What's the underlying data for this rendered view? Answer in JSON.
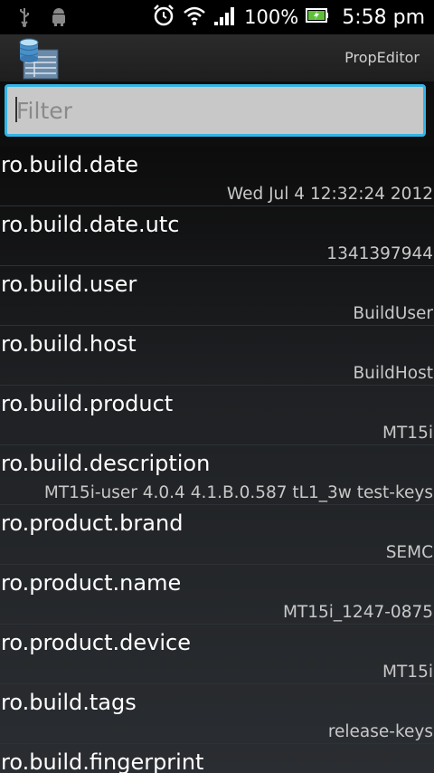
{
  "status_bar": {
    "left_icons": [
      "usb-icon",
      "android-debug-icon"
    ],
    "right_icons": [
      "alarm-clock-icon",
      "wifi-icon",
      "signal-icon",
      "battery-icon"
    ],
    "battery_percent": "100%",
    "time": "5:58 pm"
  },
  "action_bar": {
    "app_icon": "database-icon",
    "title": "PropEditor"
  },
  "filter": {
    "placeholder": "Filter",
    "value": ""
  },
  "props": [
    {
      "key": "ro.build.date",
      "value": "Wed Jul 4 12:32:24 2012"
    },
    {
      "key": "ro.build.date.utc",
      "value": "1341397944"
    },
    {
      "key": "ro.build.user",
      "value": "BuildUser"
    },
    {
      "key": "ro.build.host",
      "value": "BuildHost"
    },
    {
      "key": "ro.build.product",
      "value": "MT15i"
    },
    {
      "key": "ro.build.description",
      "value": "MT15i-user 4.0.4 4.1.B.0.587 tL1_3w test-keys"
    },
    {
      "key": "ro.product.brand",
      "value": "SEMC"
    },
    {
      "key": "ro.product.name",
      "value": "MT15i_1247-0875"
    },
    {
      "key": "ro.product.device",
      "value": "MT15i"
    },
    {
      "key": "ro.build.tags",
      "value": "release-keys"
    },
    {
      "key": "ro.build.fingerprint",
      "value": ""
    }
  ],
  "colors": {
    "accent": "#33b5e5",
    "background": "#000000",
    "list_key_text": "#ffffff",
    "list_value_text": "#c8c8c8"
  }
}
